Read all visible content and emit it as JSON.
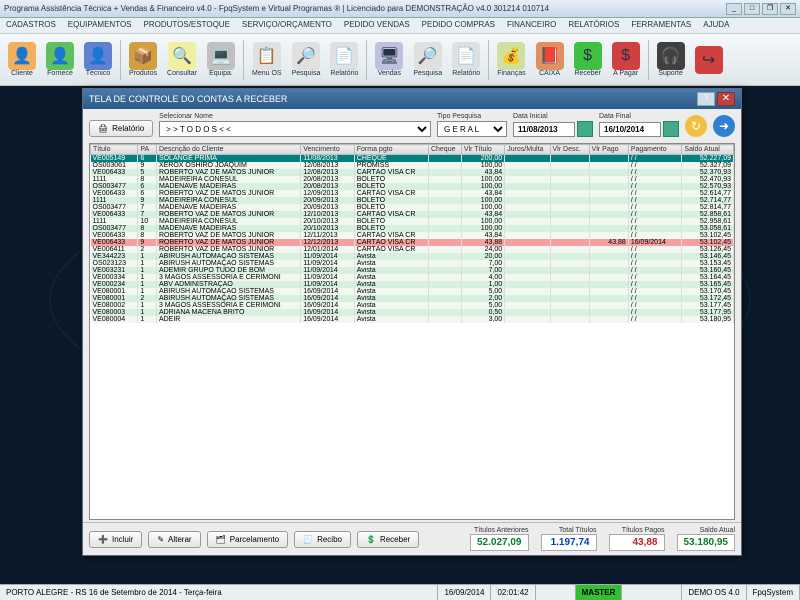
{
  "app": {
    "title": "Programa Assistência Técnica + Vendas & Financeiro v4.0 - FpqSystem e Virtual Programas ® | Licenciado para  DEMONSTRAÇÃO v4.0 301214 010714"
  },
  "menu": [
    "CADASTROS",
    "EQUIPAMENTOS",
    "PRODUTOS/ESTOQUE",
    "SERVIÇO/ORÇAMENTO",
    "PEDIDO VENDAS",
    "PEDIDO COMPRAS",
    "FINANCEIRO",
    "RELATÓRIOS",
    "FERRAMENTAS",
    "AJUDA"
  ],
  "toolbar": [
    {
      "label": "Cliente",
      "ico": "👤",
      "bg": "#f0b060"
    },
    {
      "label": "Fornece",
      "ico": "👤",
      "bg": "#60c060"
    },
    {
      "label": "Técnico",
      "ico": "👤",
      "bg": "#6080d0"
    },
    {
      "label": "Produtos",
      "ico": "📦",
      "bg": "#d0a040"
    },
    {
      "label": "Consultar",
      "ico": "🔍",
      "bg": "#f0f0a0"
    },
    {
      "label": "Equipa.",
      "ico": "💻",
      "bg": "#c0c0c0"
    },
    {
      "label": "Menu OS",
      "ico": "📋",
      "bg": "#e0e0e0"
    },
    {
      "label": "Pesquisa",
      "ico": "🔎",
      "bg": "#e0e0e0"
    },
    {
      "label": "Relatório",
      "ico": "📄",
      "bg": "#e0e0e0"
    },
    {
      "label": "Vendas",
      "ico": "🖥",
      "bg": "#c0c0e0"
    },
    {
      "label": "Pesquisa",
      "ico": "🔎",
      "bg": "#e0e0e0"
    },
    {
      "label": "Relatório",
      "ico": "📄",
      "bg": "#e0e0e0"
    },
    {
      "label": "Finanças",
      "ico": "💰",
      "bg": "#d0e0a0"
    },
    {
      "label": "CAIXA",
      "ico": "📕",
      "bg": "#e09060"
    },
    {
      "label": "Receber",
      "ico": "$",
      "bg": "#40c040"
    },
    {
      "label": "A Pagar",
      "ico": "$",
      "bg": "#d04040"
    },
    {
      "label": "Suporte",
      "ico": "🎧",
      "bg": "#404040"
    },
    {
      "label": "",
      "ico": "↪",
      "bg": "#d04040"
    }
  ],
  "dialog": {
    "title": "TELA DE CONTROLE DO CONTAS A RECEBER",
    "relatorio": "Relatório",
    "sel_nome_lbl": "Selecionar Nome",
    "sel_nome_val": "> > T O D O S < <",
    "tipo_lbl": "Tipo  Pesquisa",
    "tipo_val": "G E R A L",
    "di_lbl": "Data Inicial",
    "di_val": "11/08/2013",
    "df_lbl": "Data Final",
    "df_val": "16/10/2014"
  },
  "columns": [
    "Título",
    "PA",
    "Descrição do Cliente",
    "Vencimento",
    "Forma pgto",
    "Cheque",
    "Vlr Título",
    "Juros/Multa",
    "Vlr Desc.",
    "Vlr Pago",
    "Pagamento",
    "Saldo Atual"
  ],
  "rows": [
    {
      "sel": 1,
      "c": [
        "VE005149",
        "6",
        "SOLANGE PRIMA",
        "11/08/2013",
        "CHEQUE",
        "",
        "200,00",
        "",
        "",
        "",
        "/ /",
        "52.227,09"
      ]
    },
    {
      "c": [
        "OS003061",
        "9",
        "XEROX OSHIRO JOAQUIM",
        "12/08/2013",
        "PROMISS",
        "",
        "100,00",
        "",
        "",
        "",
        "/ /",
        "52.327,09"
      ]
    },
    {
      "c": [
        "VE006433",
        "5",
        "ROBERTO VAZ DE MATOS JUNIOR",
        "12/08/2013",
        "CARTÃO VISA  CR",
        "",
        "43,84",
        "",
        "",
        "",
        "/ /",
        "52.370,93"
      ]
    },
    {
      "c": [
        "1111",
        "8",
        "MADEIREIRA  CONESUL",
        "20/08/2013",
        "BOLETO",
        "",
        "100,00",
        "",
        "",
        "",
        "/ /",
        "52.470,93"
      ]
    },
    {
      "c": [
        "OS003477",
        "6",
        "MADENAVE MADEIRAS",
        "20/08/2013",
        "BOLETO",
        "",
        "100,00",
        "",
        "",
        "",
        "/ /",
        "52.570,93"
      ]
    },
    {
      "c": [
        "VE006433",
        "6",
        "ROBERTO VAZ DE MATOS JUNIOR",
        "12/09/2013",
        "CARTÃO VISA  CR",
        "",
        "43,84",
        "",
        "",
        "",
        "/ /",
        "52.614,77"
      ]
    },
    {
      "c": [
        "1111",
        "9",
        "MADEIREIRA  CONESUL",
        "20/09/2013",
        "BOLETO",
        "",
        "100,00",
        "",
        "",
        "",
        "/ /",
        "52.714,77"
      ]
    },
    {
      "c": [
        "OS003477",
        "7",
        "MADENAVE MADEIRAS",
        "20/09/2013",
        "BOLETO",
        "",
        "100,00",
        "",
        "",
        "",
        "/ /",
        "52.814,77"
      ]
    },
    {
      "c": [
        "VE006433",
        "7",
        "ROBERTO VAZ DE MATOS JUNIOR",
        "12/10/2013",
        "CARTÃO VISA  CR",
        "",
        "43,84",
        "",
        "",
        "",
        "/ /",
        "52.858,61"
      ]
    },
    {
      "c": [
        "1111",
        "10",
        "MADEIREIRA  CONESUL",
        "20/10/2013",
        "BOLETO",
        "",
        "100,00",
        "",
        "",
        "",
        "/ /",
        "52.958,61"
      ]
    },
    {
      "c": [
        "OS003477",
        "8",
        "MADENAVE MADEIRAS",
        "20/10/2013",
        "BOLETO",
        "",
        "100,00",
        "",
        "",
        "",
        "/ /",
        "53.058,61"
      ]
    },
    {
      "c": [
        "VE006433",
        "8",
        "ROBERTO VAZ DE MATOS JUNIOR",
        "12/11/2013",
        "CARTÃO VISA  CR",
        "",
        "43,84",
        "",
        "",
        "",
        "/ /",
        "53.102,45"
      ]
    },
    {
      "hl": 1,
      "c": [
        "VE006433",
        "9",
        "ROBERTO VAZ DE MATOS JUNIOR",
        "12/12/2013",
        "CARTÃO VISA  CR",
        "",
        "43,88",
        "",
        "",
        "43,88",
        "16/09/2014",
        "53.102,45"
      ]
    },
    {
      "c": [
        "VE006411",
        "2",
        "ROBERTO VAZ DE MATOS JUNIOR",
        "12/01/2014",
        "CARTÃO VISA  CR",
        "",
        "24,00",
        "",
        "",
        "",
        "/ /",
        "53.126,45"
      ]
    },
    {
      "c": [
        "VE344223",
        "1",
        "ABIRUSH AUTOMAÇÃO SISTEMAS",
        "11/09/2014",
        "Avista",
        "",
        "20,00",
        "",
        "",
        "",
        "/ /",
        "53.146,45"
      ]
    },
    {
      "c": [
        "OS023123",
        "1",
        "ABIRUSH AUTOMAÇÃO SISTEMAS",
        "11/09/2014",
        "Avista",
        "",
        "7,00",
        "",
        "",
        "",
        "/ /",
        "53.153,45"
      ]
    },
    {
      "c": [
        "VE003231",
        "1",
        "ADEMIR GRUPO TUDO DE BOM",
        "11/09/2014",
        "Avista",
        "",
        "7,00",
        "",
        "",
        "",
        "/ /",
        "53.160,45"
      ]
    },
    {
      "c": [
        "VE000334",
        "1",
        "3 MAGOS ASSESSORIA E CERIMONI",
        "11/09/2014",
        "Avista",
        "",
        "4,00",
        "",
        "",
        "",
        "/ /",
        "53.164,45"
      ]
    },
    {
      "c": [
        "VE000234",
        "1",
        "ABV ADMINISTRAÇÃO",
        "11/09/2014",
        "Avista",
        "",
        "1,00",
        "",
        "",
        "",
        "/ /",
        "53.165,45"
      ]
    },
    {
      "c": [
        "VE080001",
        "1",
        "ABIRUSH AUTOMAÇÃO SISTEMAS",
        "16/09/2014",
        "Avista",
        "",
        "5,00",
        "",
        "",
        "",
        "/ /",
        "53.170,45"
      ]
    },
    {
      "c": [
        "VE080001",
        "2",
        "ABIRUSH AUTOMAÇÃO SISTEMAS",
        "16/09/2014",
        "Avista",
        "",
        "2,00",
        "",
        "",
        "",
        "/ /",
        "53.172,45"
      ]
    },
    {
      "c": [
        "VE080002",
        "1",
        "3 MAGOS ASSESSORIA E CERIMONI",
        "16/09/2014",
        "Avista",
        "",
        "5,00",
        "",
        "",
        "",
        "/ /",
        "53.177,45"
      ]
    },
    {
      "c": [
        "VE080003",
        "1",
        "ADRIANA MACENA BRITO",
        "16/09/2014",
        "Avista",
        "",
        "0,50",
        "",
        "",
        "",
        "/ /",
        "53.177,95"
      ]
    },
    {
      "c": [
        "VE080004",
        "1",
        "ADEIR",
        "16/09/2014",
        "Avista",
        "",
        "3,00",
        "",
        "",
        "",
        "/ /",
        "53.180,95"
      ]
    }
  ],
  "footer": {
    "incluir": "Incluir",
    "alterar": "Alterar",
    "parcelamento": "Parcelamento",
    "recibo": "Recibo",
    "receber": "Receber",
    "totals": [
      {
        "lbl": "Títulos Anteriores",
        "val": "52.027,09",
        "cls": "g"
      },
      {
        "lbl": "Total Títulos",
        "val": "1.197,74",
        "cls": "b"
      },
      {
        "lbl": "Títulos Pagos",
        "val": "43,88",
        "cls": "r"
      },
      {
        "lbl": "Saldo Atual",
        "val": "53.180,95",
        "cls": "g"
      }
    ]
  },
  "status": {
    "left": "PORTO ALEGRE - RS 16 de Setembro de 2014 - Terça-feira",
    "date": "16/09/2014",
    "time": "02:01:42",
    "master": "MASTER",
    "demo": "DEMO OS 4.0",
    "brand": "FpqSystem"
  }
}
